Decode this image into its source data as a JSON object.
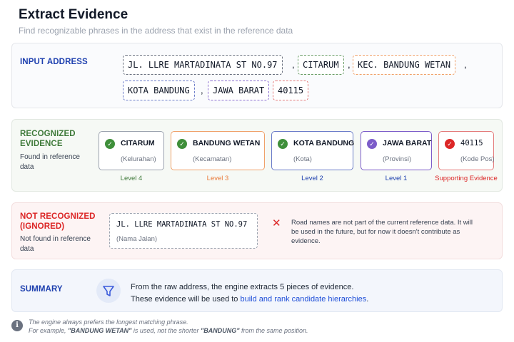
{
  "header": {
    "title": "Extract Evidence",
    "subtitle": "Find recognizable phrases in the address that exist in the reference data"
  },
  "input": {
    "label": "INPUT ADDRESS",
    "tokens": [
      "JL. LLRE MARTADINATA ST NO.97",
      "CITARUM",
      "KEC. BANDUNG WETAN",
      "KOTA BANDUNG",
      "JAWA BARAT",
      "40115"
    ],
    "separator": ","
  },
  "recognized": {
    "label_line1": "RECOGNIZED",
    "label_line2": "EVIDENCE",
    "desc": "Found in reference data",
    "cards": [
      {
        "name": "CITARUM",
        "type": "(Kelurahan)",
        "level": "Level 4"
      },
      {
        "name": "BANDUNG WETAN",
        "type": "(Kecamatan)",
        "level": "Level 3"
      },
      {
        "name": "KOTA BANDUNG",
        "type": "(Kota)",
        "level": "Level 2"
      },
      {
        "name": "JAWA BARAT",
        "type": "(Provinsi)",
        "level": "Level 1"
      },
      {
        "name": "40115",
        "type": "(Kode Pos)",
        "level": "Supporting Evidence"
      }
    ]
  },
  "not_recognized": {
    "label_line1": "NOT RECOGNIZED",
    "label_line2": "(IGNORED)",
    "desc": "Not found in reference data",
    "road_name": "JL. LLRE MARTADINATA ST NO.97",
    "road_type": "(Nama Jalan)",
    "explanation": "Road names are not part of the current reference data. It will be used in the future, but for now it doesn't contribute as evidence."
  },
  "summary": {
    "label": "SUMMARY",
    "line1": "From the raw address, the engine extracts 5 pieces of evidence.",
    "line2_prefix": "These evidence will be used to ",
    "line2_link": "build and rank candidate hierarchies",
    "line2_suffix": "."
  },
  "note": {
    "line1": "The engine always prefers the longest matching phrase.",
    "line2_prefix": "For example, ",
    "line2_long": "\"BANDUNG WETAN\"",
    "line2_mid": " is used, not the shorter ",
    "line2_short": "\"BANDUNG\"",
    "line2_suffix": " from the same position."
  },
  "colors": {
    "blue_label": "#1e40af",
    "green_label": "#3f7a3a",
    "red_label": "#dc2626",
    "green": "#3f8f3a",
    "orange": "#f0a16a",
    "blue": "#6b7cc9",
    "purple": "#7c5cc9",
    "red": "#dc2626"
  },
  "icons": {
    "check": "check-circle-icon",
    "x": "x-icon",
    "filter": "filter-funnel-icon",
    "info": "info-icon"
  }
}
